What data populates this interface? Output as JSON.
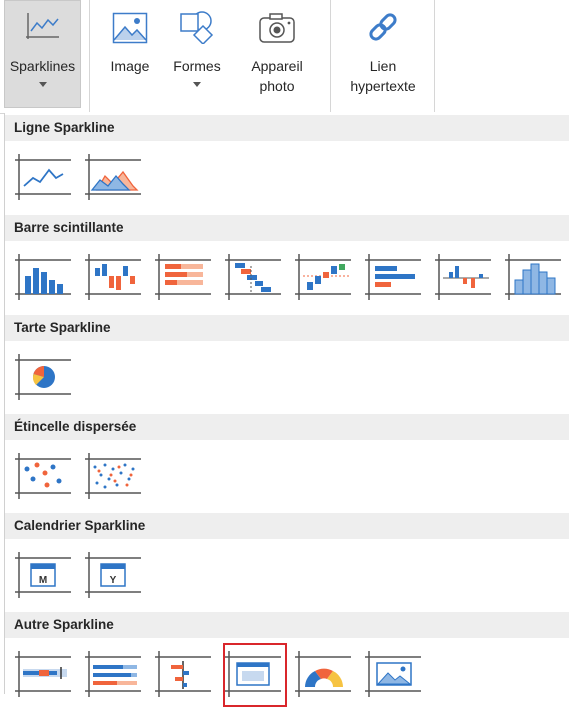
{
  "ribbon": {
    "buttons": [
      {
        "id": "sparklines",
        "label": "Sparklines",
        "icon": "sparklines-icon",
        "dropdown": true,
        "active": true
      },
      {
        "id": "image",
        "label": "Image",
        "icon": "image-icon"
      },
      {
        "id": "formes",
        "label": "Formes",
        "icon": "shapes-icon",
        "dropdown": true
      },
      {
        "id": "photo",
        "label_line1": "Appareil",
        "label_line2": "photo",
        "icon": "camera-icon"
      },
      {
        "id": "lien",
        "label_line1": "Lien",
        "label_line2": "hypertexte",
        "icon": "link-icon"
      }
    ]
  },
  "gallery": {
    "sections": [
      {
        "title": "Ligne Sparkline",
        "items": [
          "line-sparkline-icon",
          "area-sparkline-icon"
        ]
      },
      {
        "title": "Barre scintillante",
        "items": [
          "column-sparkline-icon",
          "winloss-sparkline-icon",
          "stacked-bar-sparkline-icon",
          "cascade-sparkline-icon",
          "vertical-cascade-sparkline-icon",
          "hbar-sparkline-icon",
          "variance-sparkline-icon",
          "histogram-sparkline-icon"
        ]
      },
      {
        "title": "Tarte Sparkline",
        "items": [
          "pie-sparkline-icon"
        ]
      },
      {
        "title": "Étincelle dispersée",
        "items": [
          "scatter-sparkline-icon",
          "dense-scatter-sparkline-icon"
        ]
      },
      {
        "title": "Calendrier Sparkline",
        "items": [
          "month-calendar-sparkline-icon",
          "year-calendar-sparkline-icon"
        ]
      },
      {
        "title": "Autre Sparkline",
        "items": [
          "bullet-sparkline-icon",
          "spread-sparkline-icon",
          "boxplot-sparkline-icon",
          "image-sparkline-icon",
          "gauge-sparkline-icon",
          "picture-sparkline-icon"
        ]
      }
    ],
    "calendar_labels": {
      "month": "M",
      "year": "Y"
    },
    "selected_item": "image-sparkline-icon"
  },
  "colors": {
    "accent_blue": "#2e75c6",
    "accent_orange": "#f0643c",
    "light_orange": "#f8b69a",
    "frame": "#555555",
    "selection": "#d9262b",
    "section_header_bg": "#eeeeee"
  }
}
